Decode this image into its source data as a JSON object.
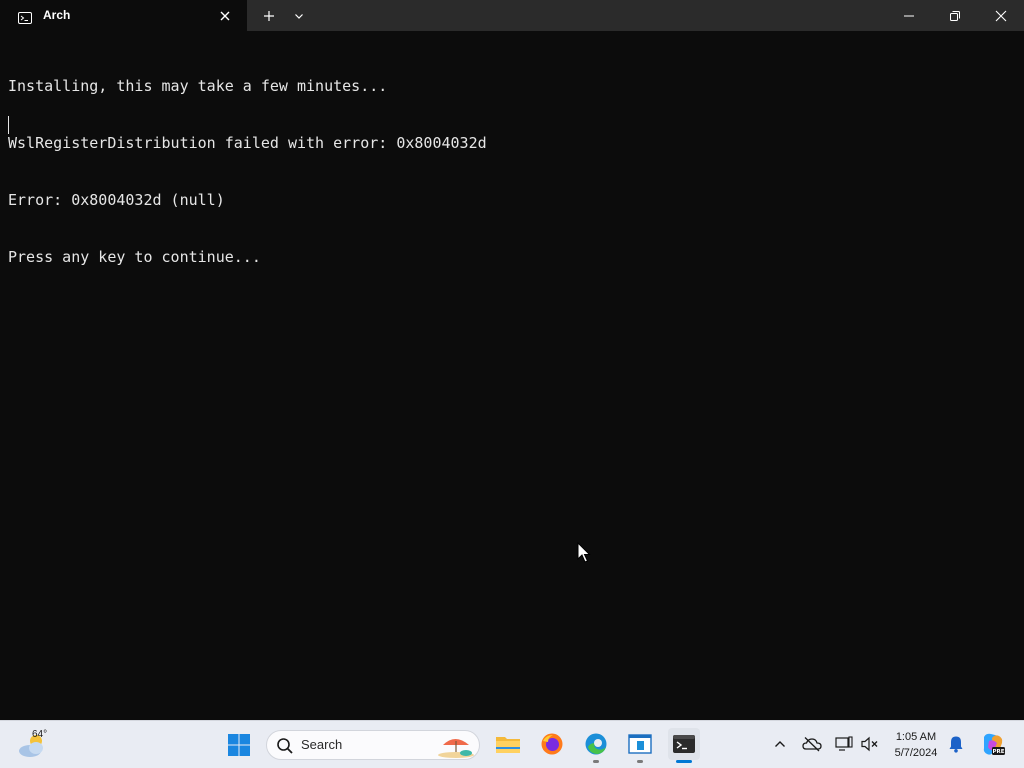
{
  "window": {
    "tab_title": "Arch"
  },
  "terminal": {
    "lines": [
      "Installing, this may take a few minutes...",
      "WslRegisterDistribution failed with error: 0x8004032d",
      "Error: 0x8004032d (null)",
      "Press any key to continue..."
    ]
  },
  "taskbar": {
    "weather_temp": "64°",
    "search_placeholder": "Search",
    "pinned_apps": [
      "start-icon",
      "file-explorer-icon",
      "firefox-icon",
      "edge-icon",
      "app-window-icon",
      "terminal-icon"
    ],
    "active_app": "terminal-icon"
  },
  "tray": {
    "icons": [
      "chevron-up-icon",
      "onedrive-off-icon",
      "network-icon",
      "sound-muted-icon",
      "notification-bell-icon",
      "copilot-icon"
    ],
    "time": "1:05 AM",
    "date": "5/7/2024"
  },
  "colors": {
    "terminal_bg": "#0c0c0c",
    "terminal_text": "#e6e6e6",
    "titlebar_bg": "#2b2b2b",
    "taskbar_bg": "#e9ecf3",
    "accent": "#0078d4"
  }
}
